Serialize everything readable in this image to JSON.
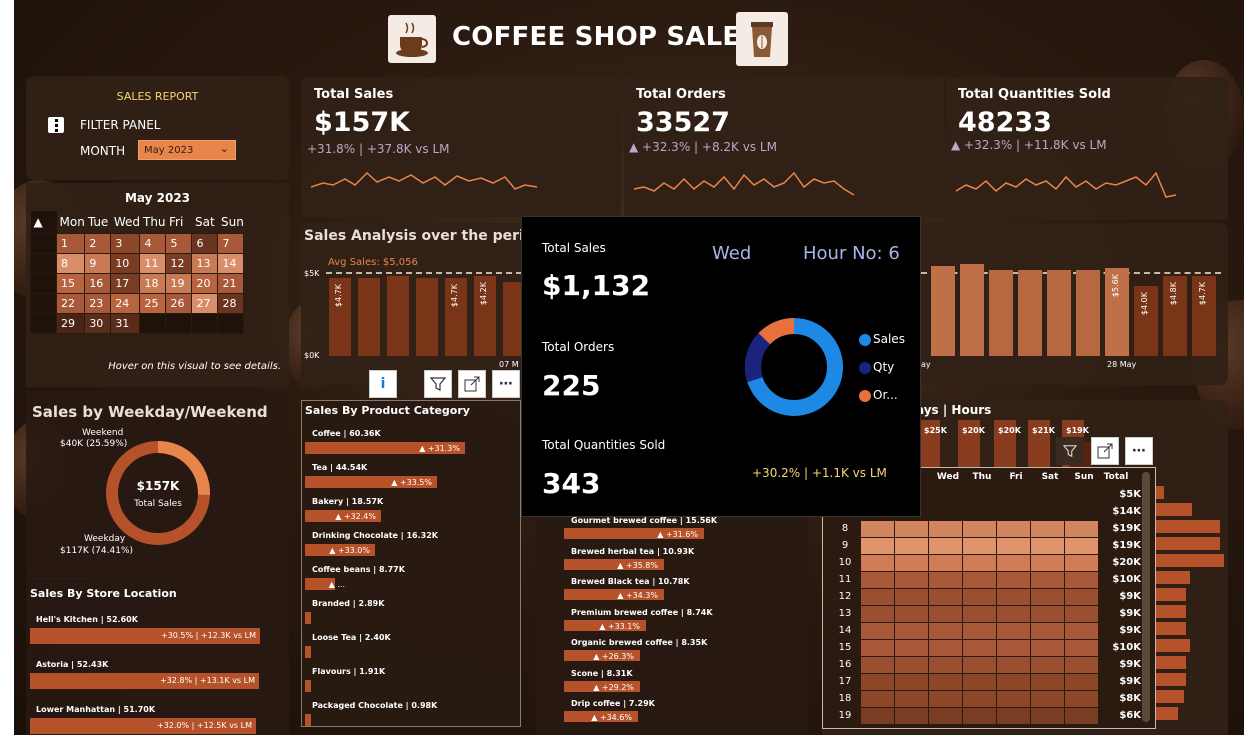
{
  "header": {
    "title": "COFFEE SHOP SALES"
  },
  "filter": {
    "report_label": "SALES REPORT",
    "panel_label": "FILTER PANEL",
    "month_label": "MONTH",
    "month_value": "May 2023"
  },
  "calendar": {
    "title": "May 2023",
    "weekdays": [
      "Mon",
      "Tue",
      "Wed",
      "Thu",
      "Fri",
      "Sat",
      "Sun"
    ],
    "hint": "Hover on this visual to see details."
  },
  "kpis": [
    {
      "title": "Total Sales",
      "value": "$157K",
      "delta": "+31.8% | +37.8K vs LM"
    },
    {
      "title": "Total Orders",
      "value": "33527",
      "delta": "▲ +32.3% | +8.2K vs LM"
    },
    {
      "title": "Total Quantities Sold",
      "value": "48233",
      "delta": "▲ +32.3% | +11.8K vs LM"
    }
  ],
  "weekday": {
    "title": "Sales by Weekday/Weekend",
    "center_value": "$157K",
    "center_label": "Total Sales",
    "weekend_label": "Weekend",
    "weekend_value": "$40K (25.59%)",
    "weekday_label": "Weekday",
    "weekday_value": "$117K (74.41%)"
  },
  "stores": {
    "title": "Sales By Store Location",
    "items": [
      {
        "label": "Hell's Kitchen | 52.60K",
        "delta": "+30.5% | +12.3K vs LM"
      },
      {
        "label": "Astoria | 52.43K",
        "delta": "+32.8% | +13.1K vs LM"
      },
      {
        "label": "Lower Manhattan | 51.70K",
        "delta": "+32.0% | +12.5K vs LM"
      }
    ]
  },
  "analysis": {
    "title": "Sales Analysis over the period",
    "avg_label": "Avg Sales: $5,056",
    "y_top": "$5K",
    "y_bottom": "$0K",
    "date_labels": [
      "07 M",
      "ay",
      "28 May"
    ],
    "left_bar_labels": [
      "$4.7K",
      "",
      "",
      "",
      "$4.7K",
      "$4.2K"
    ],
    "right_bar_labels": [
      "",
      "",
      "",
      "",
      "",
      "",
      "$5.6K",
      "$4.0K",
      "$4.8K",
      "$4.7K"
    ]
  },
  "category": {
    "title": "Sales By Product Category",
    "items": [
      {
        "label": "Coffee | 60.36K",
        "delta": "▲ +31.3%"
      },
      {
        "label": "Tea | 44.54K",
        "delta": "▲ +33.5%"
      },
      {
        "label": "Bakery | 18.57K",
        "delta": "▲ +32.4%"
      },
      {
        "label": "Drinking Chocolate | 16.32K",
        "delta": "▲ +33.0%"
      },
      {
        "label": "Coffee beans | 8.77K",
        "delta": "▲ ..."
      },
      {
        "label": "Branded | 2.89K",
        "delta": ""
      },
      {
        "label": "Loose Tea | 2.40K",
        "delta": ""
      },
      {
        "label": "Flavours | 1.91K",
        "delta": ""
      },
      {
        "label": "Packaged Chocolate | 0.98K",
        "delta": ""
      }
    ]
  },
  "products": {
    "items": [
      {
        "label": "Gourmet brewed coffee | 15.56K",
        "delta": "▲ +31.6%"
      },
      {
        "label": "Brewed herbal tea | 10.93K",
        "delta": "▲ +35.8%"
      },
      {
        "label": "Brewed Black tea | 10.78K",
        "delta": "▲ +34.3%"
      },
      {
        "label": "Premium brewed coffee | 8.74K",
        "delta": "▲ +33.1%"
      },
      {
        "label": "Organic brewed coffee | 8.35K",
        "delta": "▲ +26.3%"
      },
      {
        "label": "Scone | 8.31K",
        "delta": "▲ +29.2%"
      },
      {
        "label": "Drip coffee | 7.29K",
        "delta": "▲ +34.6%"
      }
    ]
  },
  "heatmap": {
    "title": "ays | Hours",
    "col_totals": [
      "$25K",
      "$20K",
      "$20K",
      "$21K",
      "$19K"
    ],
    "columns": [
      "Wed",
      "Thu",
      "Fri",
      "Sat",
      "Sun",
      "Total"
    ],
    "rows": [
      {
        "hour": "",
        "total": "$5K"
      },
      {
        "hour": "",
        "total": "$14K"
      },
      {
        "hour": "8",
        "total": "$19K"
      },
      {
        "hour": "9",
        "total": "$19K"
      },
      {
        "hour": "10",
        "total": "$20K"
      },
      {
        "hour": "11",
        "total": "$10K"
      },
      {
        "hour": "12",
        "total": "$9K"
      },
      {
        "hour": "13",
        "total": "$9K"
      },
      {
        "hour": "14",
        "total": "$9K"
      },
      {
        "hour": "15",
        "total": "$10K"
      },
      {
        "hour": "16",
        "total": "$9K"
      },
      {
        "hour": "17",
        "total": "$9K"
      },
      {
        "hour": "18",
        "total": "$8K"
      },
      {
        "hour": "19",
        "total": "$6K"
      }
    ]
  },
  "tooltip": {
    "day": "Wed",
    "hour": "Hour No: 6",
    "sales_label": "Total Sales",
    "sales_value": "$1,132",
    "orders_label": "Total Orders",
    "orders_value": "225",
    "qty_label": "Total Quantities Sold",
    "qty_value": "343",
    "delta": "+30.2% | +1.1K vs LM",
    "legend": [
      "Sales",
      "Qty",
      "Or..."
    ],
    "colors": {
      "sales": "#1e88e5",
      "qty": "#1a237e",
      "orders": "#e8703a"
    }
  },
  "colors": {
    "accent": "#b5522a",
    "panel": "#30201a",
    "highlight": "#e8703a"
  }
}
